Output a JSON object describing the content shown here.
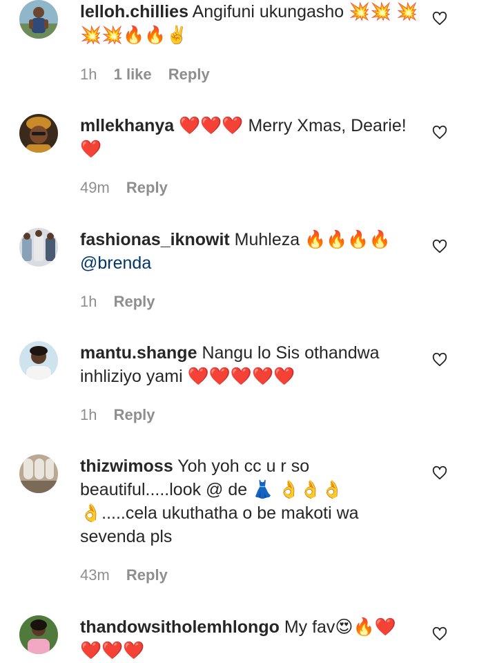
{
  "comments": [
    {
      "username": "lelloh.chillies",
      "text_parts": [
        "Angifuni ukungasho 💥💥 💥💥💥🔥🔥✌️"
      ],
      "time": "1h",
      "likes": "1 like",
      "reply": "Reply",
      "avatar": "avatar-photo-person-outdoors"
    },
    {
      "username": "mllekhanya",
      "text_parts": [
        "❤️❤️❤️ Merry Xmas, Dearie!❤️"
      ],
      "time": "49m",
      "likes": "",
      "reply": "Reply",
      "avatar": "avatar-photo-person-headwrap"
    },
    {
      "username": "fashionas_iknowit",
      "text_parts": [
        "Muhleza 🔥🔥🔥🔥"
      ],
      "mention": "@brenda",
      "time": "1h",
      "likes": "",
      "reply": "Reply",
      "avatar": "avatar-photo-group"
    },
    {
      "username": "mantu.shange",
      "text_parts": [
        "Nangu lo Sis othandwa inhliziyo yami ❤️❤️❤️❤️❤️"
      ],
      "time": "1h",
      "likes": "",
      "reply": "Reply",
      "avatar": "avatar-photo-person-smiling"
    },
    {
      "username": "thizwimoss",
      "text_parts": [
        "Yoh yoh cc u r so beautiful.....look @ de 👗 👌👌👌 👌.....cela ukuthatha o be makoti wa sevenda pls"
      ],
      "time": "43m",
      "likes": "",
      "reply": "Reply",
      "avatar": "avatar-photo-room"
    },
    {
      "username": "thandowsitholemhlongo",
      "text_parts": [
        "My fav😍🔥❤️ ❤️❤️❤️"
      ],
      "time": "",
      "likes": "",
      "reply": "",
      "avatar": "avatar-photo-person-pink"
    }
  ],
  "icons": {
    "like": "heart-outline-icon"
  },
  "colors": {
    "text": "#262626",
    "meta": "#8e8e8e",
    "mention": "#00376b",
    "background": "#ffffff"
  }
}
